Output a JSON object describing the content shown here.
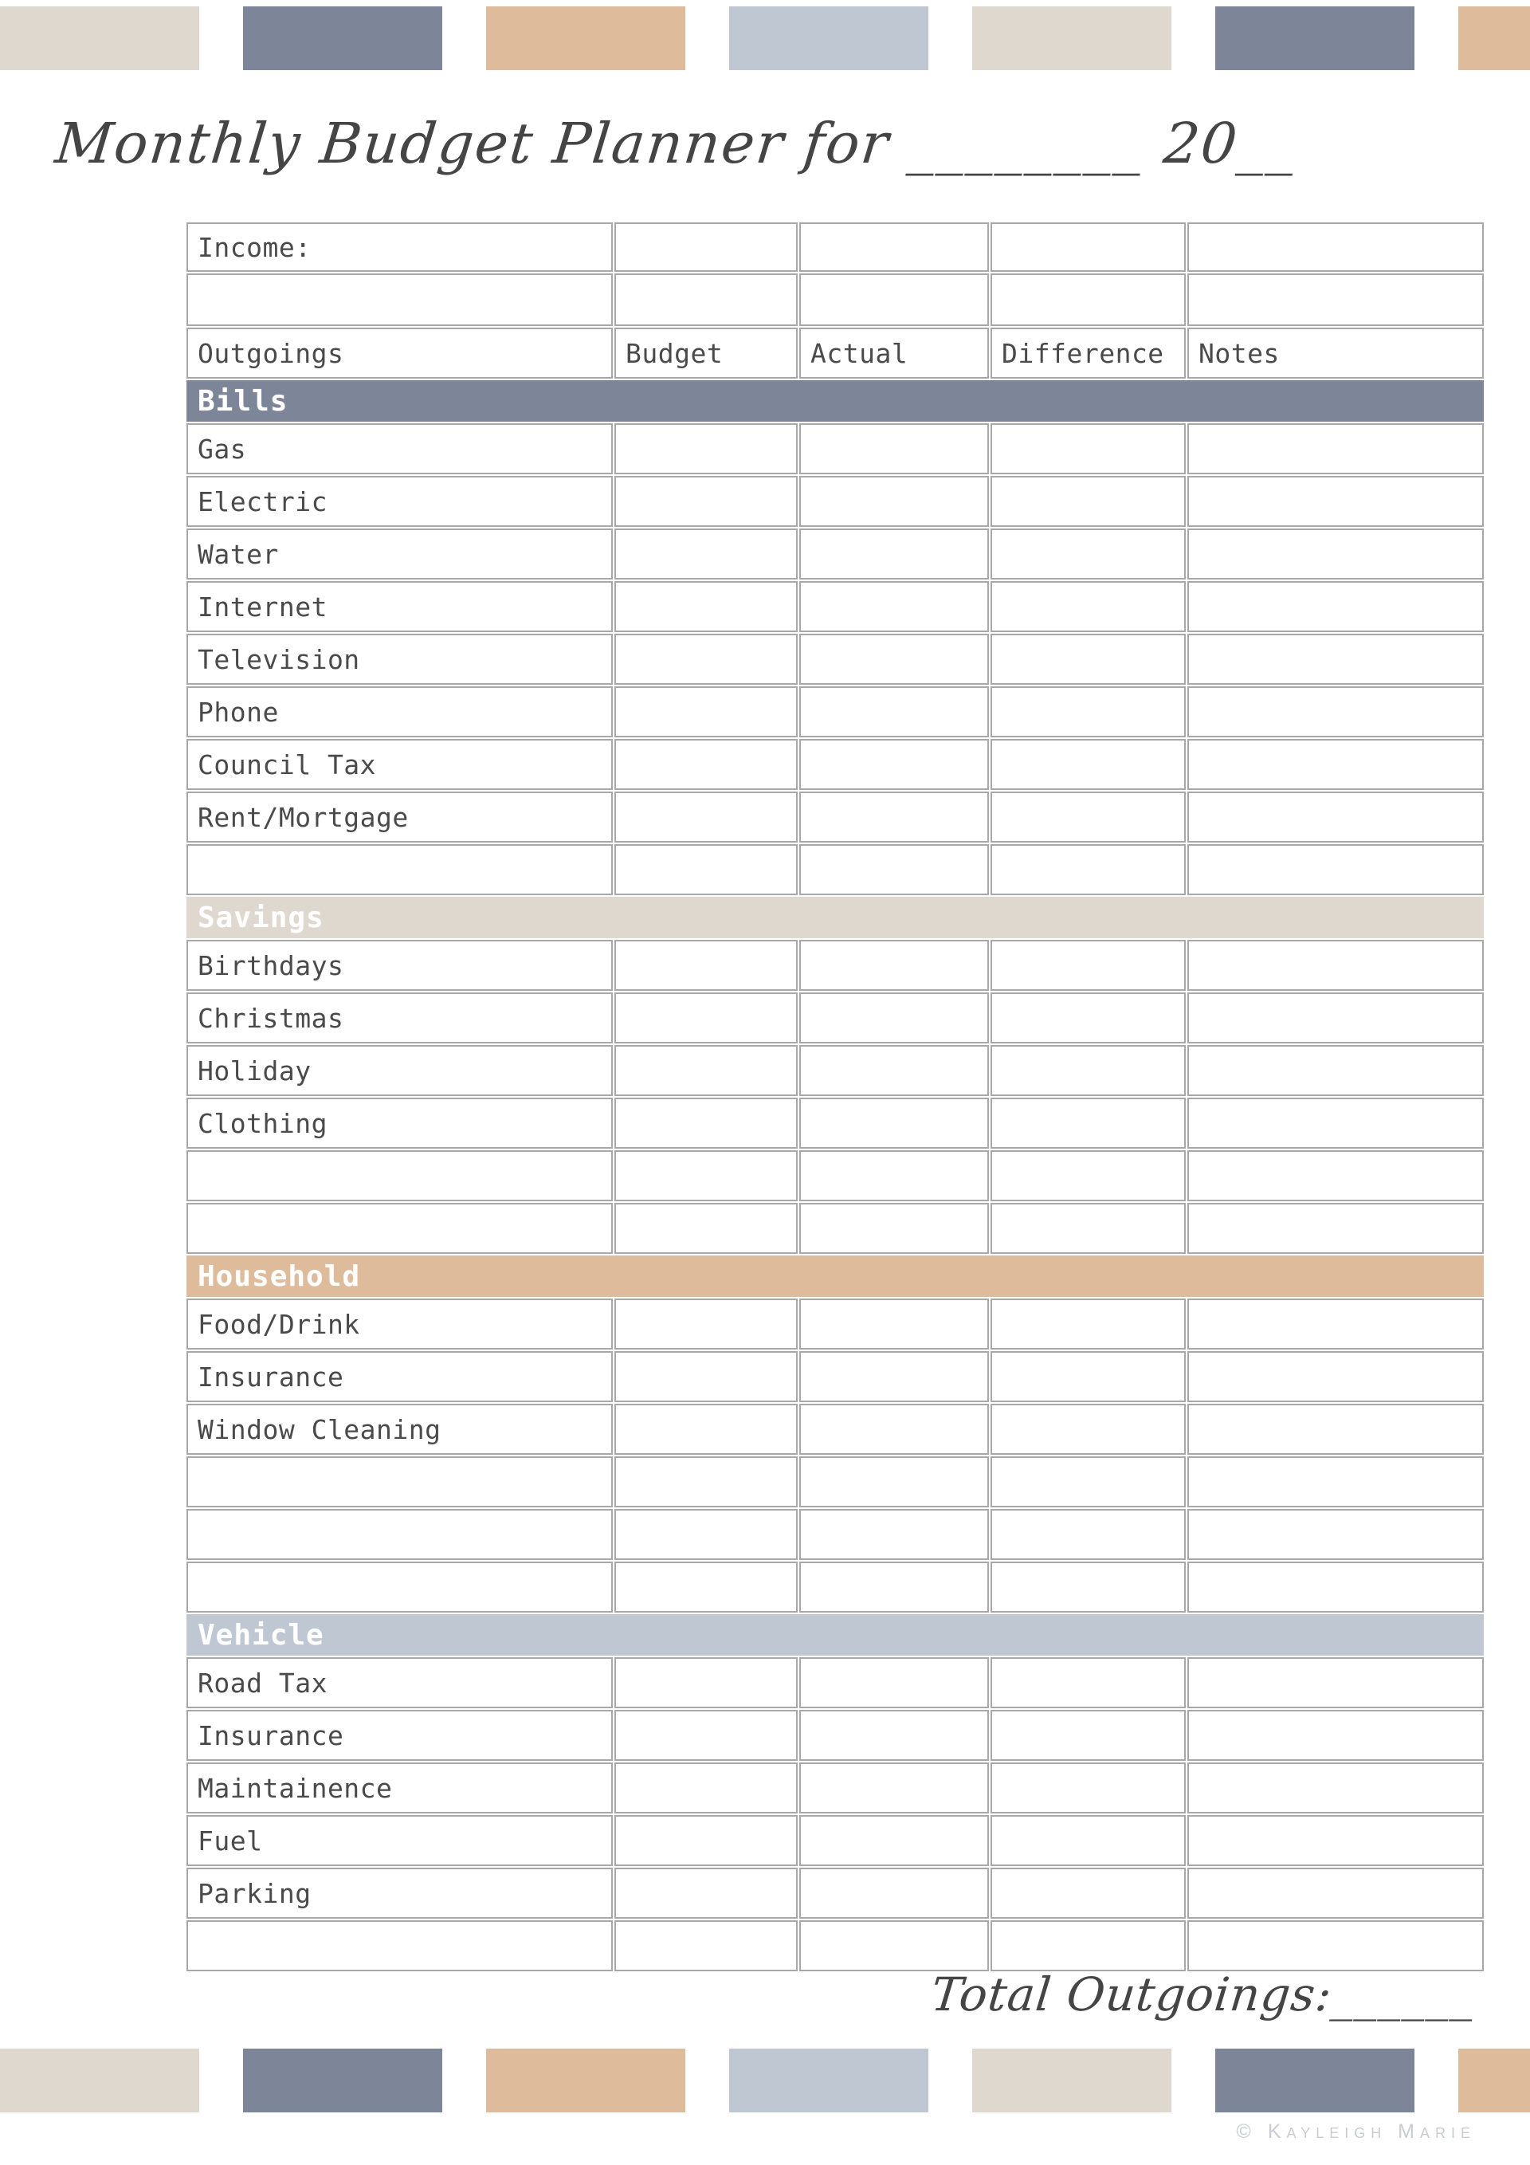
{
  "palette": {
    "bills": "#7D8598",
    "savings": "#DED8CE",
    "household": "#DEBB9B",
    "vehicle": "#BFC8D2",
    "border": "#A8A8A8",
    "text": "#4A4A4A",
    "section_text": "#FFFFFF",
    "credit_text": "#C9CCD2",
    "page_background": "#FFFFFF"
  },
  "decor": {
    "top_swatches": [
      "#DED8CE",
      "#7D8598",
      "#DEBB9B",
      "#BFC8D2",
      "#DED8CE",
      "#7D8598",
      "#DEBB9B"
    ],
    "bottom_swatches": [
      "#DED8CE",
      "#7D8598",
      "#DEBB9B",
      "#BFC8D2",
      "#DED8CE",
      "#7D8598",
      "#DEBB9B"
    ]
  },
  "header": {
    "title": "Monthly Budget Planner for ________ 20__"
  },
  "table": {
    "income_label": "Income:",
    "columns": [
      "Outgoings",
      "Budget",
      "Actual",
      "Difference",
      "Notes"
    ],
    "sections": [
      {
        "name": "Bills",
        "color": "#7D8598",
        "rows": [
          "Gas",
          "Electric",
          "Water",
          "Internet",
          "Television",
          "Phone",
          "Council Tax",
          "Rent/Mortgage"
        ],
        "blank_rows": 1
      },
      {
        "name": "Savings",
        "color": "#DED8CE",
        "rows": [
          "Birthdays",
          "Christmas",
          "Holiday",
          "Clothing"
        ],
        "blank_rows": 2
      },
      {
        "name": "Household",
        "color": "#DEBB9B",
        "rows": [
          "Food/Drink",
          "Insurance",
          "Window Cleaning"
        ],
        "blank_rows": 3
      },
      {
        "name": "Vehicle",
        "color": "#BFC8D2",
        "rows": [
          "Road Tax",
          "Insurance",
          "Maintainence",
          "Fuel",
          "Parking"
        ],
        "blank_rows": 1
      }
    ]
  },
  "footer": {
    "total_label": "Total Outgoings:______",
    "copyright_mark": "©",
    "copyright_name": "Kayleigh Marie"
  }
}
